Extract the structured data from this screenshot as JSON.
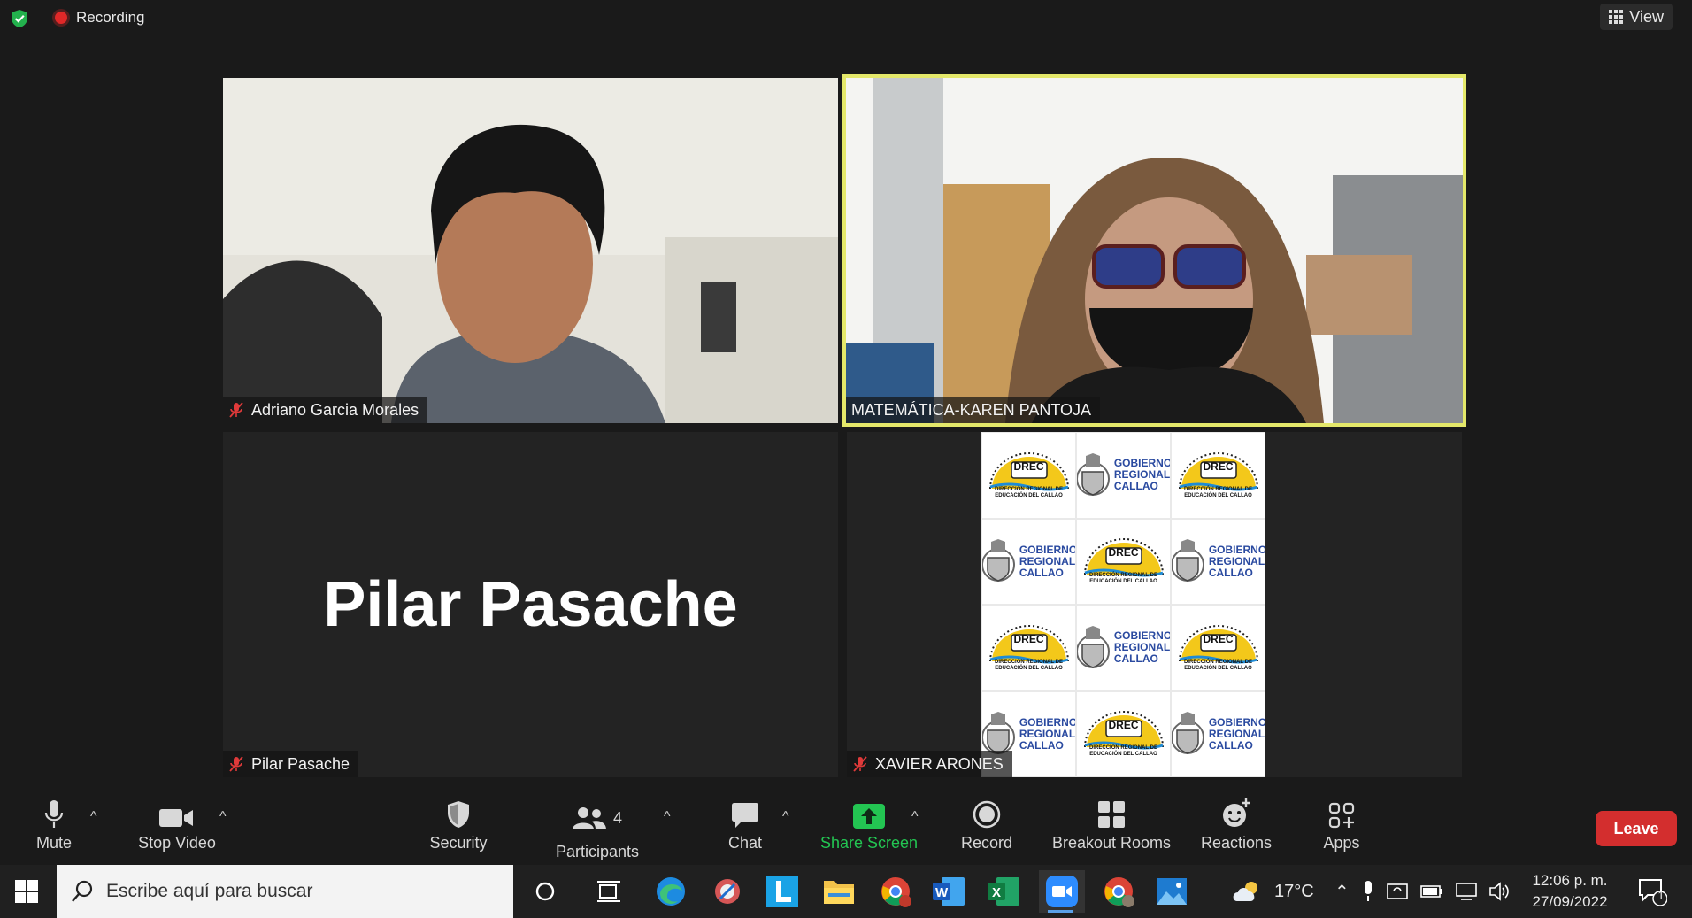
{
  "top": {
    "recording_label": "Recording",
    "view_label": "View"
  },
  "participants": [
    {
      "name": "Adriano Garcia Morales",
      "muted": true
    },
    {
      "name": "MATEMÁTICA-KAREN PANTOJA",
      "muted": false,
      "active_speaker": true
    },
    {
      "name": "Pilar Pasache",
      "muted": true,
      "video_off": true
    },
    {
      "name": "XAVIER ARONES",
      "muted": true
    }
  ],
  "logo_tiles": {
    "drec_title": "DREC",
    "drec_sub1": "DIRECCIÓN REGIONAL DE",
    "drec_sub2": "EDUCACIÓN DEL CALLAO",
    "gob_line1": "GOBIERNO",
    "gob_line2": "REGIONAL",
    "gob_line3": "CALLAO"
  },
  "toolbar": {
    "mute": "Mute",
    "stop_video": "Stop Video",
    "security": "Security",
    "participants": "Participants",
    "participants_count": "4",
    "chat": "Chat",
    "share_screen": "Share Screen",
    "record": "Record",
    "breakout_rooms": "Breakout Rooms",
    "reactions": "Reactions",
    "apps": "Apps",
    "leave": "Leave"
  },
  "taskbar": {
    "search_placeholder": "Escribe aquí para buscar",
    "temperature": "17°C",
    "time": "12:06 p. m.",
    "date": "27/09/2022",
    "notification_count": "1"
  },
  "colors": {
    "active_speaker_border": "#e4e86a",
    "leave_bg": "#d32e2e",
    "share_green": "#23c552",
    "muted_red": "#e03a3a"
  }
}
